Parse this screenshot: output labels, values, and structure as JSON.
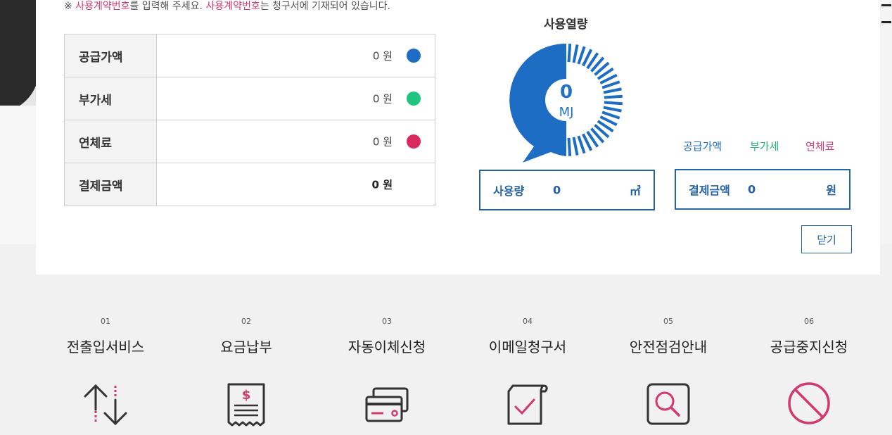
{
  "notice": {
    "prefix": "※ ",
    "highlight1": "사용계약번호",
    "middle": "를 입력해 주세요. ",
    "highlight2": "사용계약번호",
    "suffix": "는 청구서에 기재되어 있습니다."
  },
  "fee_table": [
    {
      "label": "공급가액",
      "amount": "0 원",
      "dot_color": "#1d6dc4"
    },
    {
      "label": "부가세",
      "amount": "0 원",
      "dot_color": "#1fc47f"
    },
    {
      "label": "연체료",
      "amount": "0 원",
      "dot_color": "#d8285e"
    },
    {
      "label": "결제금액",
      "amount": "0 원"
    }
  ],
  "usage": {
    "title": "사용열량",
    "value": "0",
    "unit": "MJ"
  },
  "legend": {
    "supply": "공급가액",
    "vat": "부가세",
    "late": "연체료"
  },
  "usage_box": {
    "label": "사용량",
    "value": "0",
    "unit": "㎥"
  },
  "pay_box": {
    "label": "결제금액",
    "value": "0",
    "unit": "원"
  },
  "close_label": "닫기",
  "services": [
    {
      "num": "01",
      "name": "전출입서비스",
      "icon": "transfer-arrows-icon"
    },
    {
      "num": "02",
      "name": "요금납부",
      "icon": "receipt-icon"
    },
    {
      "num": "03",
      "name": "자동이체신청",
      "icon": "cards-icon"
    },
    {
      "num": "04",
      "name": "이메일청구서",
      "icon": "email-bill-icon"
    },
    {
      "num": "05",
      "name": "안전점검안내",
      "icon": "search-icon"
    },
    {
      "num": "06",
      "name": "공급중지신청",
      "icon": "prohibit-icon"
    }
  ],
  "colors": {
    "primary": "#2470c9",
    "accent": "#d2396a",
    "green": "#1fc47f"
  }
}
